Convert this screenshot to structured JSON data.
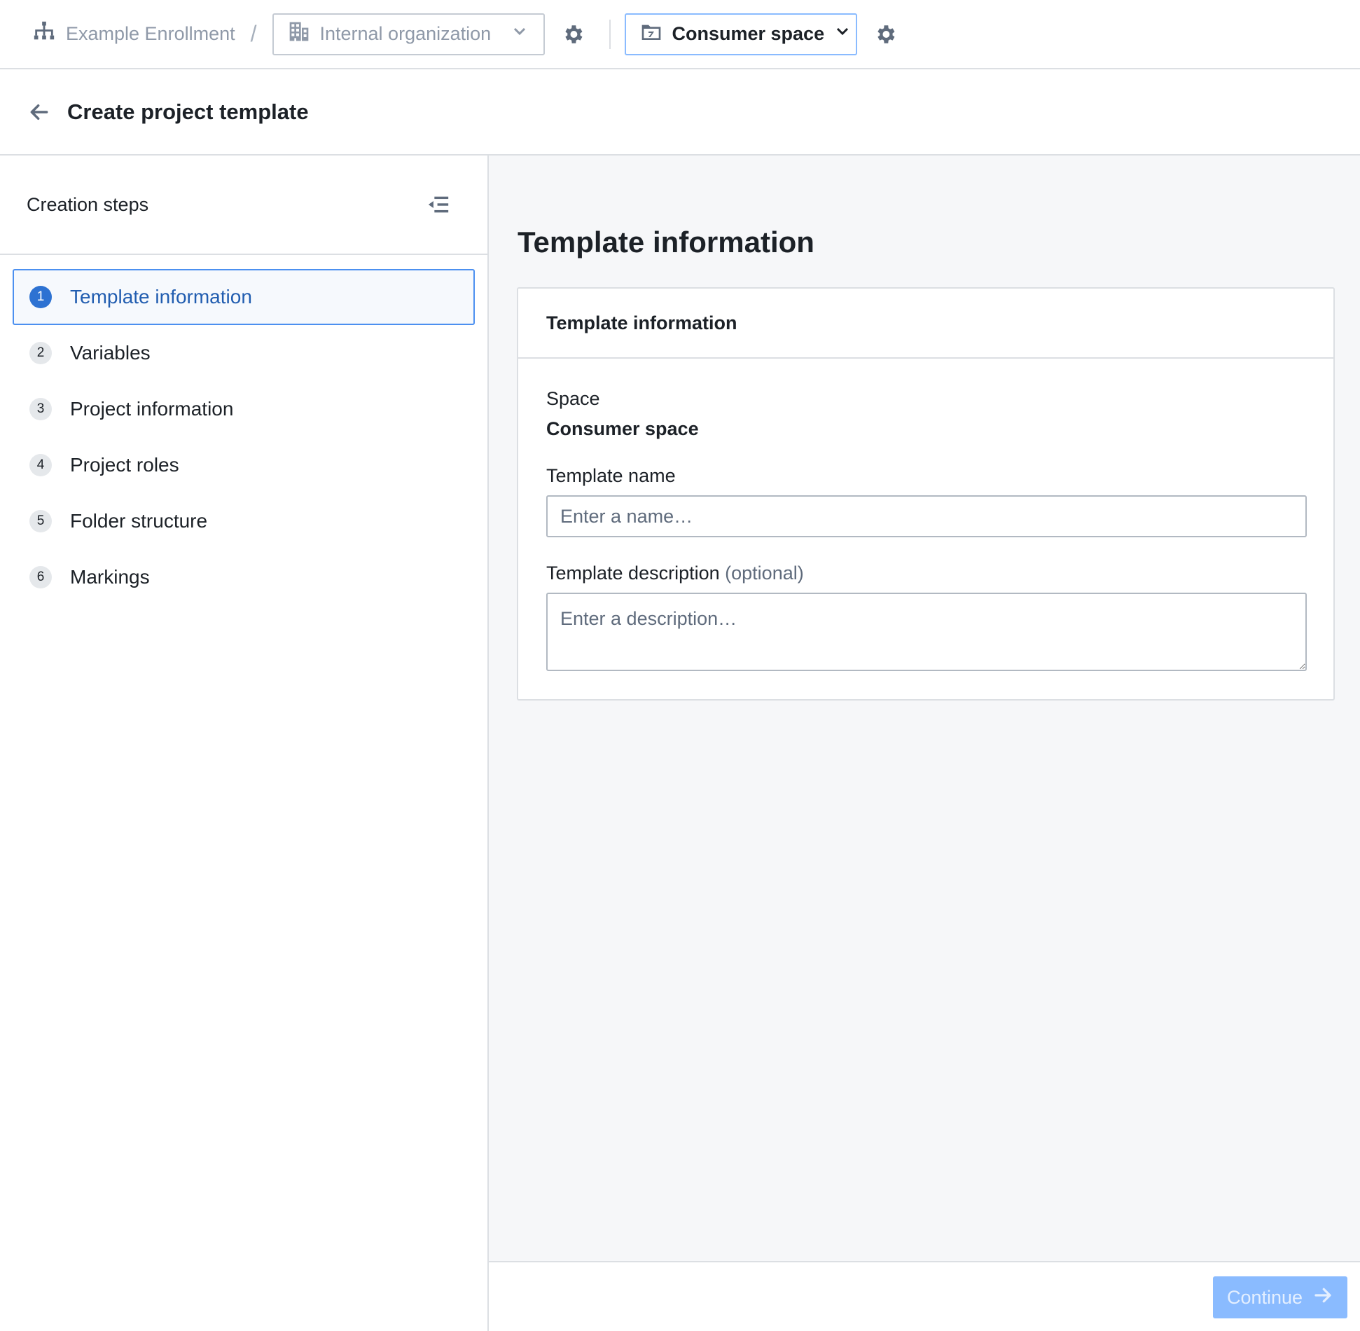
{
  "topbar": {
    "enrollment": "Example Enrollment",
    "separator": "/",
    "organization": "Internal organization",
    "space": "Consumer space"
  },
  "header": {
    "title": "Create project template"
  },
  "sidebar": {
    "title": "Creation steps",
    "steps": [
      {
        "num": "1",
        "label": "Template information"
      },
      {
        "num": "2",
        "label": "Variables"
      },
      {
        "num": "3",
        "label": "Project information"
      },
      {
        "num": "4",
        "label": "Project roles"
      },
      {
        "num": "5",
        "label": "Folder structure"
      },
      {
        "num": "6",
        "label": "Markings"
      }
    ]
  },
  "main": {
    "title": "Template information",
    "card": {
      "title": "Template information",
      "space_label": "Space",
      "space_value": "Consumer space",
      "name_label": "Template name",
      "name_placeholder": "Enter a name…",
      "name_value": "",
      "description_label": "Template description",
      "description_optional": "(optional)",
      "description_placeholder": "Enter a description…",
      "description_value": ""
    }
  },
  "footer": {
    "continue_label": "Continue"
  },
  "colors": {
    "accent": "#2d72d2",
    "active_text": "#215db0",
    "button_disabled": "#8abbff",
    "icon_gray": "#5f6b7c"
  }
}
